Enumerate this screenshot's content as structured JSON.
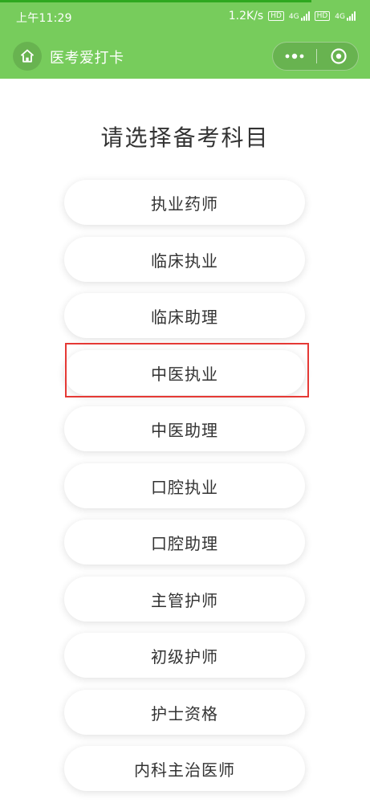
{
  "status_bar": {
    "time": "上午11:29",
    "speed": "1.2K/s",
    "hd_badge_1": "HD",
    "net_1": "4G",
    "hd_badge_2": "HD",
    "net_2": "4G"
  },
  "title_bar": {
    "title": "医考爱打卡",
    "home_icon": "home-icon",
    "menu_icon": "more-dots-icon",
    "close_icon": "target-icon"
  },
  "page": {
    "heading": "请选择备考科目",
    "subjects": [
      {
        "label": "执业药师"
      },
      {
        "label": "临床执业"
      },
      {
        "label": "临床助理"
      },
      {
        "label": "中医执业"
      },
      {
        "label": "中医助理"
      },
      {
        "label": "口腔执业"
      },
      {
        "label": "口腔助理"
      },
      {
        "label": "主管护师"
      },
      {
        "label": "初级护师"
      },
      {
        "label": "护士资格"
      },
      {
        "label": "内科主治医师"
      }
    ],
    "selected_subject": "中医执业"
  },
  "colors": {
    "header_bg": "#77cc5c",
    "highlight": "#e53935"
  }
}
